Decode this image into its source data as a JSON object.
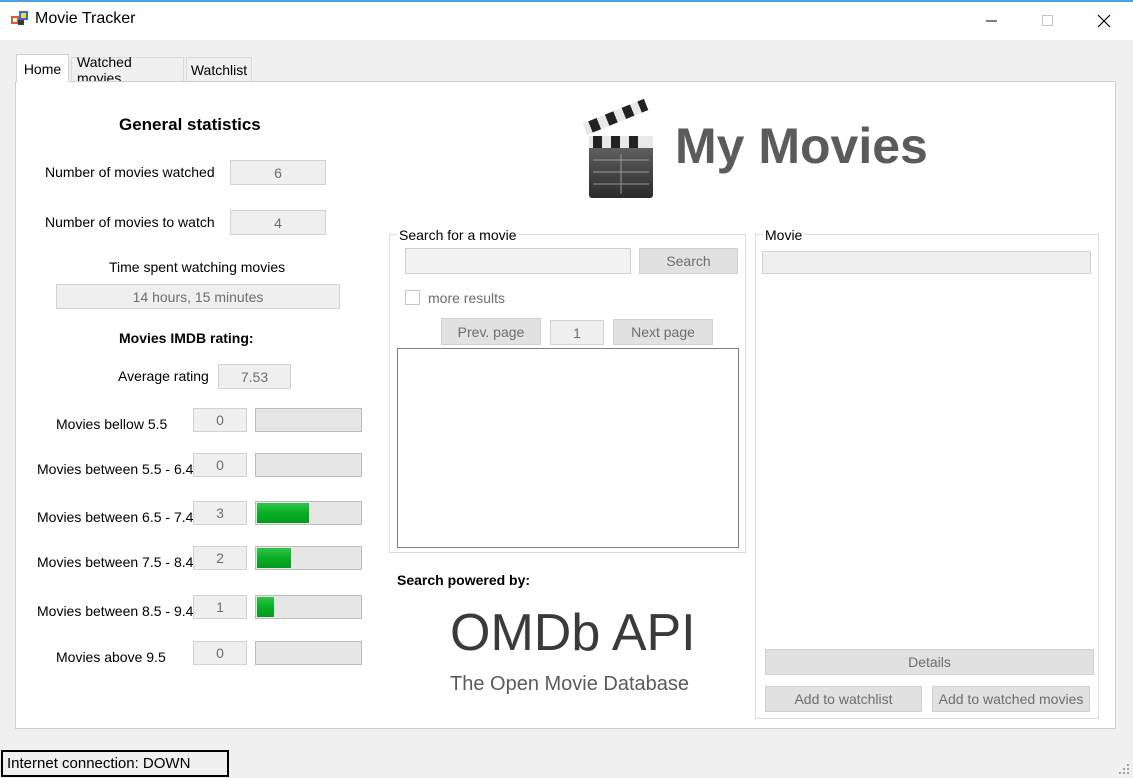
{
  "window": {
    "title": "Movie Tracker"
  },
  "tabs": [
    {
      "label": "Home"
    },
    {
      "label": "Watched movies"
    },
    {
      "label": "Watchlist"
    }
  ],
  "stats": {
    "heading": "General statistics",
    "watched_label": "Number of movies watched",
    "watched_value": "6",
    "towatch_label": "Number of movies to watch",
    "towatch_value": "4",
    "time_label": "Time spent watching movies",
    "time_value": "14 hours, 15 minutes"
  },
  "rating": {
    "heading": "Movies IMDB rating:",
    "average_label": "Average rating",
    "average_value": "7.53",
    "buckets": [
      {
        "label": "Movies bellow 5.5",
        "count": "0",
        "fraction": 0
      },
      {
        "label": "Movies between 5.5 - 6.4",
        "count": "0",
        "fraction": 0
      },
      {
        "label": "Movies between 6.5 - 7.4",
        "count": "3",
        "fraction": 0.5
      },
      {
        "label": "Movies between 7.5 - 8.4",
        "count": "2",
        "fraction": 0.333
      },
      {
        "label": "Movies between 8.5 - 9.4",
        "count": "1",
        "fraction": 0.167
      },
      {
        "label": "Movies above 9.5",
        "count": "0",
        "fraction": 0
      }
    ]
  },
  "logo": {
    "text": "My Movies"
  },
  "search": {
    "group_label": "Search for a movie",
    "query": "",
    "button": "Search",
    "more_results": "more results",
    "prev": "Prev. page",
    "page": "1",
    "next": "Next page"
  },
  "powered": {
    "label": "Search powered by:",
    "api": "OMDb API",
    "tagline": "The Open Movie Database"
  },
  "movie": {
    "group_label": "Movie",
    "title_value": "",
    "details": "Details",
    "add_watchlist": "Add to watchlist",
    "add_watched": "Add to watched movies"
  },
  "status": {
    "text": "Internet connection: DOWN"
  },
  "colors": {
    "progress": "#06b025",
    "status_border": "#000000"
  },
  "icons": [
    "app-icon",
    "minimize-icon",
    "maximize-icon",
    "close-icon",
    "clapperboard-icon",
    "resize-grip-icon"
  ]
}
